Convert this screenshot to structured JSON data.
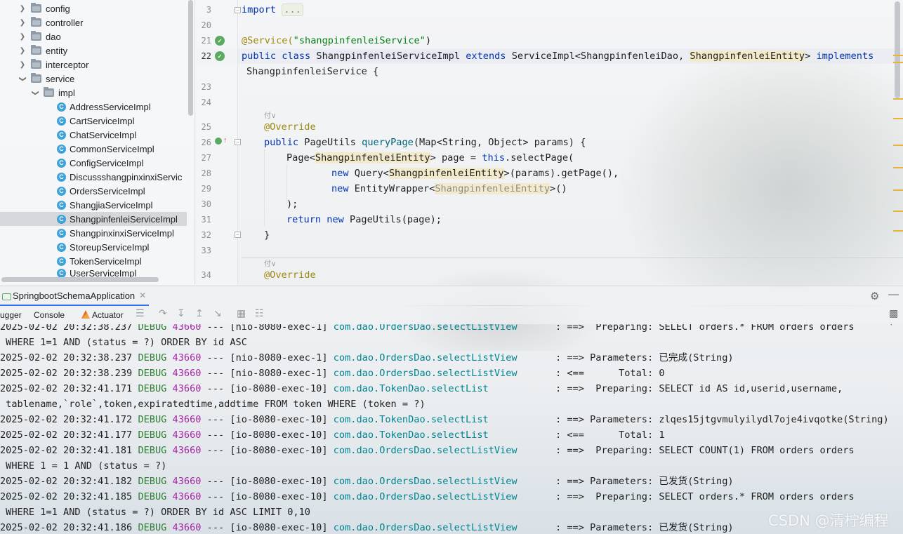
{
  "project_tree": {
    "items": [
      {
        "label": "config",
        "type": "folder",
        "expanded": false
      },
      {
        "label": "controller",
        "type": "folder",
        "expanded": false
      },
      {
        "label": "dao",
        "type": "folder",
        "expanded": false
      },
      {
        "label": "entity",
        "type": "folder",
        "expanded": false
      },
      {
        "label": "interceptor",
        "type": "folder",
        "expanded": false
      },
      {
        "label": "service",
        "type": "folder",
        "expanded": true
      },
      {
        "label": "impl",
        "type": "folder",
        "expanded": true
      },
      {
        "label": "AddressServiceImpl",
        "type": "class"
      },
      {
        "label": "CartServiceImpl",
        "type": "class"
      },
      {
        "label": "ChatServiceImpl",
        "type": "class"
      },
      {
        "label": "CommonServiceImpl",
        "type": "class"
      },
      {
        "label": "ConfigServiceImpl",
        "type": "class"
      },
      {
        "label": "DiscussshangpinxinxiServic",
        "type": "class"
      },
      {
        "label": "OrdersServiceImpl",
        "type": "class"
      },
      {
        "label": "ShangjiaServiceImpl",
        "type": "class"
      },
      {
        "label": "ShangpinfenleiServiceImpl",
        "type": "class",
        "selected": true
      },
      {
        "label": "ShangpinxinxiServiceImpl",
        "type": "class"
      },
      {
        "label": "StoreupServiceImpl",
        "type": "class"
      },
      {
        "label": "TokenServiceImpl",
        "type": "class"
      },
      {
        "label": "UserServiceImpl",
        "type": "class"
      }
    ],
    "class_icon_letter": "C"
  },
  "editor": {
    "line_numbers": [
      "3",
      "20",
      "21",
      "22",
      "",
      "23",
      "24",
      "25",
      "26",
      "27",
      "28",
      "29",
      "30",
      "31",
      "32",
      "33",
      "34"
    ],
    "lines": {
      "l3_kw": "import",
      "l3_folded": "...",
      "l21_ann": "@Service(",
      "l21_str": "\"shangpinfenleiService\"",
      "l21_end": ")",
      "l22_kw1": "public",
      "l22_kw2": "class",
      "l22_name": "ShangpinfenleiServiceImpl",
      "l22_ext": "extends",
      "l22_base": "ServiceImpl<ShangpinfenleiDao, ",
      "l22_entity": "ShangpinfenleiEntity",
      "l22_gt": ">",
      "l22_impl": "implements",
      "l22b_iface": "ShangpinfenleiService {",
      "hint1": "付∨",
      "l25_ann": "@Override",
      "l26_kw": "public",
      "l26_type": "PageUtils",
      "l26_m": "queryPage",
      "l26_rest": "(Map<String, Object> params) {",
      "l27_a": "Page<",
      "l27_entity": "ShangpinfenleiEntity",
      "l27_b": "> page = ",
      "l27_this": "this",
      "l27_c": ".selectPage(",
      "l28_new": "new",
      "l28_a": "Query<",
      "l28_entity": "ShangpinfenleiEntity",
      "l28_b": ">(params).getPage(),",
      "l29_new": "new",
      "l29_a": "EntityWrapper<",
      "l29_entity": "ShangpinfenleiEntity",
      "l29_b": ">()",
      "l30": ");",
      "l31_ret": "return",
      "l31_new": "new",
      "l31_rest": "PageUtils(page);",
      "l32": "}",
      "hint2": "付∨",
      "l34_ann": "@Override"
    }
  },
  "run_window": {
    "tab_label": "SpringbootSchemaApplication",
    "toolbar_tabs": {
      "debugger": "ugger",
      "console": "Console",
      "actuator": "Actuator"
    }
  },
  "console": {
    "lines": [
      {
        "ts": "2025-02-02 20:32:38.237",
        "lvl": "DEBUG",
        "pid": "43660",
        "thread": "--- [nio-8080-exec-1]",
        "logger": "com.dao.OrdersDao.selectListView",
        "msg": ": ==>  Preparing: SELECT orders.* FROM orders orders"
      },
      {
        "cont": " WHERE 1=1 AND (status = ?) ORDER BY id ASC"
      },
      {
        "ts": "2025-02-02 20:32:38.237",
        "lvl": "DEBUG",
        "pid": "43660",
        "thread": "--- [nio-8080-exec-1]",
        "logger": "com.dao.OrdersDao.selectListView",
        "msg": ": ==> Parameters: 已完成(String)"
      },
      {
        "ts": "2025-02-02 20:32:38.239",
        "lvl": "DEBUG",
        "pid": "43660",
        "thread": "--- [nio-8080-exec-1]",
        "logger": "com.dao.OrdersDao.selectListView",
        "msg": ": <==      Total: 0"
      },
      {
        "ts": "2025-02-02 20:32:41.171",
        "lvl": "DEBUG",
        "pid": "43660",
        "thread": "--- [io-8080-exec-10]",
        "logger": "com.dao.TokenDao.selectList",
        "msg": ": ==>  Preparing: SELECT id AS id,userid,username,"
      },
      {
        "cont": " tablename,`role`,token,expiratedtime,addtime FROM token WHERE (token = ?)"
      },
      {
        "ts": "2025-02-02 20:32:41.172",
        "lvl": "DEBUG",
        "pid": "43660",
        "thread": "--- [io-8080-exec-10]",
        "logger": "com.dao.TokenDao.selectList",
        "msg": ": ==> Parameters: zlqes15jtgvmulyilydl7oje4ivqotke(String)"
      },
      {
        "ts": "2025-02-02 20:32:41.177",
        "lvl": "DEBUG",
        "pid": "43660",
        "thread": "--- [io-8080-exec-10]",
        "logger": "com.dao.TokenDao.selectList",
        "msg": ": <==      Total: 1"
      },
      {
        "ts": "2025-02-02 20:32:41.181",
        "lvl": "DEBUG",
        "pid": "43660",
        "thread": "--- [io-8080-exec-10]",
        "logger": "com.dao.OrdersDao.selectListView",
        "msg": ": ==>  Preparing: SELECT COUNT(1) FROM orders orders"
      },
      {
        "cont": " WHERE 1 = 1 AND (status = ?)"
      },
      {
        "ts": "2025-02-02 20:32:41.182",
        "lvl": "DEBUG",
        "pid": "43660",
        "thread": "--- [io-8080-exec-10]",
        "logger": "com.dao.OrdersDao.selectListView",
        "msg": ": ==> Parameters: 已发货(String)"
      },
      {
        "ts": "2025-02-02 20:32:41.185",
        "lvl": "DEBUG",
        "pid": "43660",
        "thread": "--- [io-8080-exec-10]",
        "logger": "com.dao.OrdersDao.selectListView",
        "msg": ": ==>  Preparing: SELECT orders.* FROM orders orders"
      },
      {
        "cont": " WHERE 1=1 AND (status = ?) ORDER BY id ASC LIMIT 0,10"
      },
      {
        "ts": "2025-02-02 20:32:41.186",
        "lvl": "DEBUG",
        "pid": "43660",
        "thread": "--- [io-8080-exec-10]",
        "logger": "com.dao.OrdersDao.selectListView",
        "msg": ": ==> Parameters: 已发货(String)"
      }
    ]
  },
  "watermark": "CSDN @清柠编程",
  "colors": {
    "accent": "#3574f0",
    "keyword": "#0033b3",
    "annotation": "#9e880d",
    "string": "#067d17",
    "debug": "#2e7d32",
    "pid": "#a626a4",
    "logger": "#00838f"
  }
}
